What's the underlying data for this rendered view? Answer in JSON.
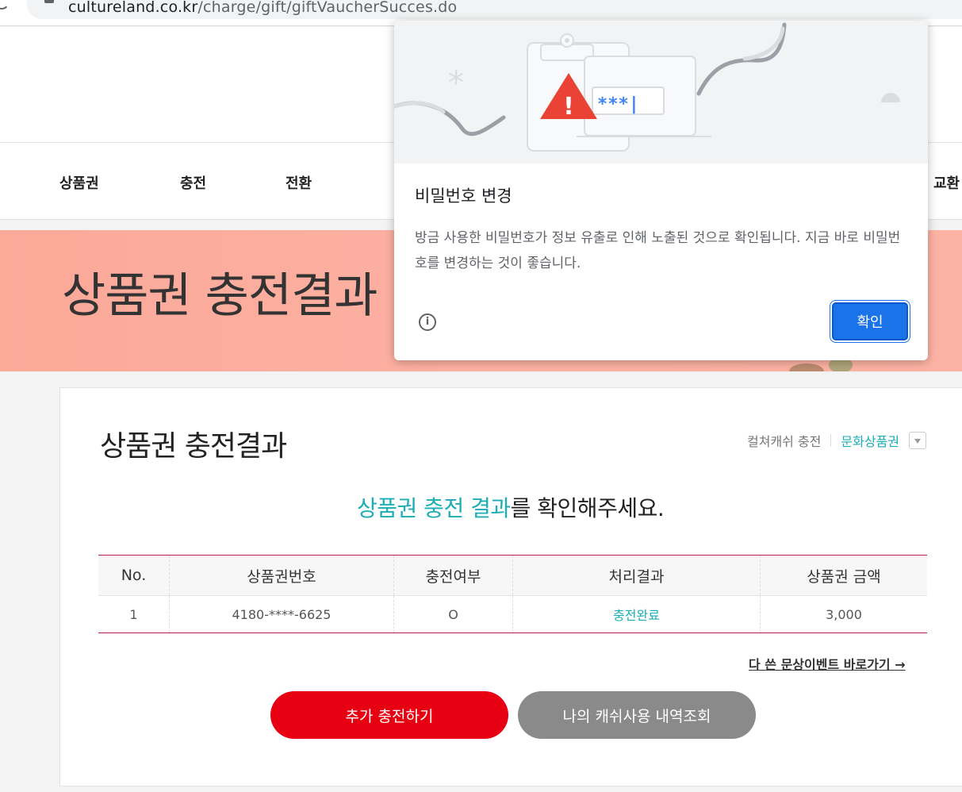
{
  "browser": {
    "url_host": "cultureland.co.kr",
    "url_path": "/charge/gift/giftVaucherSucces.do"
  },
  "nav": {
    "items": [
      "상품권",
      "충전",
      "전환",
      "교환"
    ]
  },
  "banner": {
    "title": "상품권 충전결과"
  },
  "card": {
    "title": "상품권 충전결과",
    "tabs": {
      "inactive": "컬쳐캐쉬 충전",
      "active": "문화상품권"
    },
    "message_highlight": "상품권 충전 결과",
    "message_rest": "를 확인해주세요."
  },
  "table": {
    "headers": [
      "No.",
      "상품권번호",
      "충전여부",
      "처리결과",
      "상품권 금액"
    ],
    "rows": [
      [
        "1",
        "4180-****-6625",
        "O",
        "충전완료",
        "3,000"
      ]
    ]
  },
  "links": {
    "event": "다 쓴 문상이벤트 바로가기 →"
  },
  "buttons": {
    "add_charge": "추가 충전하기",
    "history": "나의 캐쉬사용 내역조회"
  },
  "dialog": {
    "title": "비밀번호 변경",
    "body": "방금 사용한 비밀번호가 정보 유출로 인해 노출된 것으로 확인됩니다. 지금 바로 비밀번호를 변경하는 것이 좋습니다.",
    "confirm": "확인",
    "password_mask": "***|",
    "info_symbol": "i",
    "warning_symbol": "!",
    "asterisk": "*"
  },
  "colors": {
    "accent_teal": "#1cadb5",
    "primary_red": "#e60012",
    "chrome_blue": "#1a73e8",
    "warning_red": "#ea4335"
  }
}
